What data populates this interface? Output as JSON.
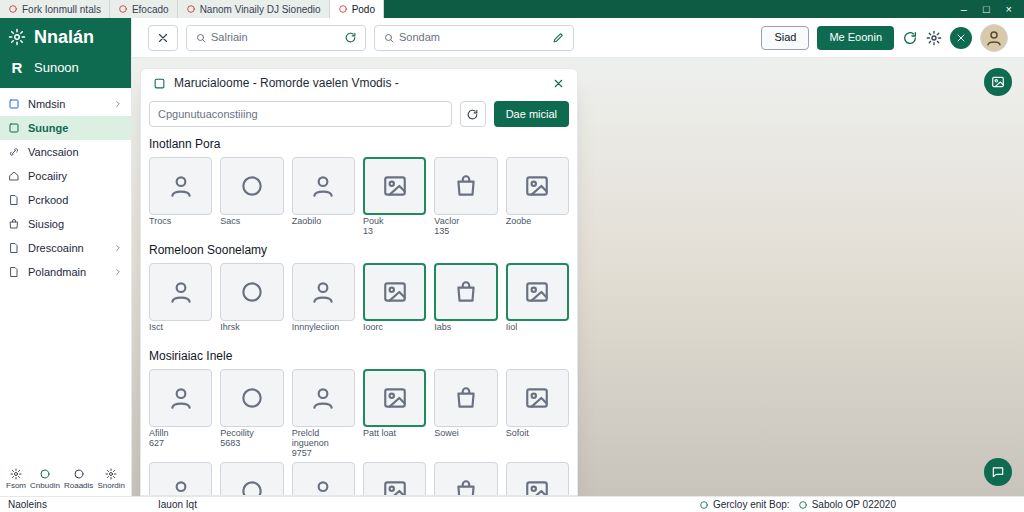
{
  "browser": {
    "tabs": [
      {
        "label": "Fork Ionmull ntals",
        "selected": false
      },
      {
        "label": "Efocado",
        "selected": false
      },
      {
        "label": "Nanom Vinaily DJ Sionedio",
        "selected": false
      },
      {
        "label": "Podo",
        "selected": true
      }
    ],
    "controls": [
      "–",
      "□",
      "×"
    ]
  },
  "sidebar": {
    "title": "Nnalán",
    "logo": "R",
    "subtitle": "Sunoon",
    "items": [
      {
        "label": "Nmdsin",
        "selected": false,
        "expandable": true
      },
      {
        "label": "Suunge",
        "selected": true,
        "expandable": false
      },
      {
        "label": "Vancsaion",
        "selected": false,
        "expandable": false
      },
      {
        "label": "Pocaiiry",
        "selected": false,
        "expandable": false
      },
      {
        "label": "Pcrkood",
        "selected": false,
        "expandable": false
      },
      {
        "label": "Siusiog",
        "selected": false,
        "expandable": false
      },
      {
        "label": "Drescoainn",
        "selected": false,
        "expandable": true
      },
      {
        "label": "Polandmain",
        "selected": false,
        "expandable": true
      }
    ],
    "footer": [
      "Fsom",
      "Cnbudin",
      "Roaadis",
      "Snordin"
    ]
  },
  "toolbar": {
    "search_left": {
      "placeholder": "Salriain"
    },
    "search_right": {
      "placeholder": "Sondam"
    },
    "buttons": [
      "Siad",
      "Me Eoonin"
    ]
  },
  "modal": {
    "title": "Marucialoome - Romorde vaelen Vmodis -",
    "search": {
      "placeholder": "Cpgunutuaconstiiing"
    },
    "action": "Dae micial",
    "sections": [
      {
        "title": "Inotlann Pora",
        "cards": [
          {
            "label": "Trocs",
            "sub": "",
            "selected": false
          },
          {
            "label": "Sacs",
            "sub": "",
            "selected": false
          },
          {
            "label": "Zaobilo",
            "sub": "",
            "selected": false
          },
          {
            "label": "Pouk",
            "sub": "13",
            "selected": true
          },
          {
            "label": "Vaclor",
            "sub": "135",
            "selected": false
          },
          {
            "label": "Zoobe",
            "sub": "",
            "selected": false
          }
        ]
      },
      {
        "title": "Romeloon Soonelamy",
        "cards": [
          {
            "label": "Isct",
            "sub": "",
            "selected": false
          },
          {
            "label": "Ihrsk",
            "sub": "",
            "selected": false
          },
          {
            "label": "Innnyleciion",
            "sub": "",
            "selected": false
          },
          {
            "label": "Ioorc",
            "sub": "",
            "selected": true
          },
          {
            "label": "Iabs",
            "sub": "",
            "selected": true
          },
          {
            "label": "Iiol",
            "sub": "",
            "selected": true
          }
        ]
      },
      {
        "title": "Mosiriaiac Inele",
        "cards": [
          {
            "label": "Afilln",
            "sub": "627",
            "selected": false
          },
          {
            "label": "Pecoility",
            "sub": "5683",
            "selected": false
          },
          {
            "label": "Prelcld inguenon",
            "sub": "9757",
            "selected": false
          },
          {
            "label": "Patt loat",
            "sub": "",
            "selected": true
          },
          {
            "label": "Sowei",
            "sub": "",
            "selected": false
          },
          {
            "label": "Sofoit",
            "sub": "",
            "selected": false
          },
          {
            "label": "",
            "sub": "",
            "selected": false
          },
          {
            "label": "",
            "sub": "",
            "selected": false
          },
          {
            "label": "",
            "sub": "",
            "selected": false
          },
          {
            "label": "",
            "sub": "",
            "selected": false
          },
          {
            "label": "",
            "sub": "",
            "selected": false
          },
          {
            "label": "",
            "sub": "",
            "selected": false
          }
        ]
      }
    ]
  },
  "status_bar": {
    "left": "Naoleins",
    "middle": "Iauon Iqt",
    "right": [
      "Gercloy enit Bop:",
      "Sabolo OP 022020"
    ]
  }
}
